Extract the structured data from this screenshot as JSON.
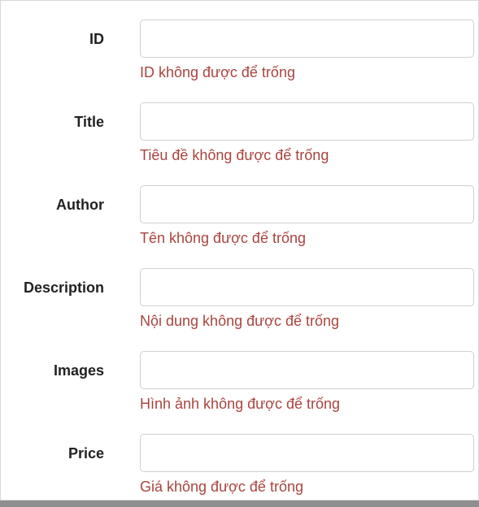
{
  "form": {
    "fields": [
      {
        "label": "ID",
        "value": "",
        "error": "ID không được để trống"
      },
      {
        "label": "Title",
        "value": "",
        "error": "Tiêu đề không được để trống"
      },
      {
        "label": "Author",
        "value": "",
        "error": "Tên không được để trống"
      },
      {
        "label": "Description",
        "value": "",
        "error": "Nội dung không được để trống"
      },
      {
        "label": "Images",
        "value": "",
        "error": "Hình ảnh không được để trống"
      },
      {
        "label": "Price",
        "value": "",
        "error": "Giá không được để trống"
      }
    ]
  },
  "colors": {
    "error_text": "#a9443f",
    "label_text": "#222222",
    "input_border": "#cfcfcf"
  }
}
